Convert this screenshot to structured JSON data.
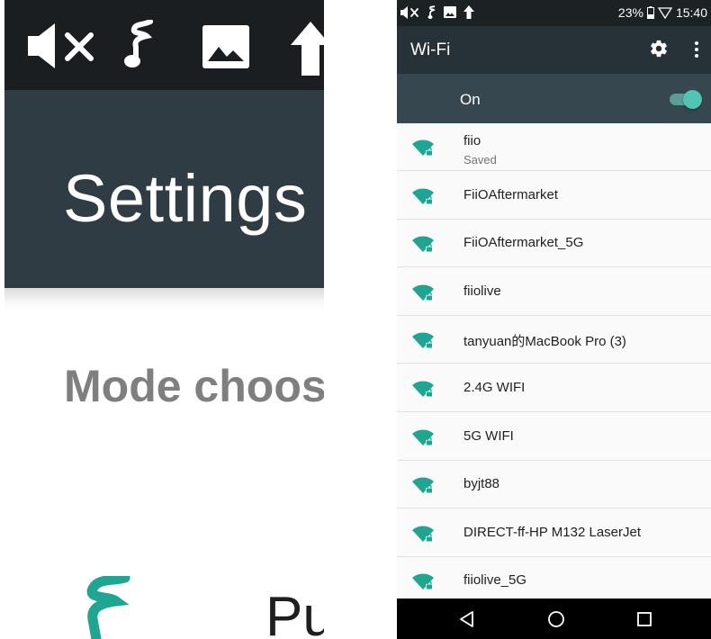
{
  "zoom_panel": {
    "title": "Settings",
    "section_label": "Mode choos",
    "item_label": "Pu",
    "status_icons": [
      "volume-muted-icon",
      "music-note-icon",
      "image-icon",
      "upload-arrow-icon"
    ],
    "logo_icon": "fiio-logo-icon"
  },
  "status_bar": {
    "left_icons": [
      "volume-muted-icon",
      "music-note-icon",
      "image-icon",
      "upload-arrow-icon"
    ],
    "battery": "23%",
    "time": "15:40"
  },
  "app_bar": {
    "title": "Wi-Fi",
    "settings_icon": "gear-icon",
    "overflow_icon": "more-vert-icon"
  },
  "wifi_toggle": {
    "label": "On",
    "state": "on"
  },
  "networks": [
    {
      "ssid": "fiio",
      "status": "Saved"
    },
    {
      "ssid": "FiiOAftermarket",
      "status": ""
    },
    {
      "ssid": "FiiOAftermarket_5G",
      "status": ""
    },
    {
      "ssid": "fiiolive",
      "status": ""
    },
    {
      "ssid": "tanyuan的MacBook Pro (3)",
      "status": ""
    },
    {
      "ssid": "2.4G WIFI",
      "status": ""
    },
    {
      "ssid": "5G WIFI",
      "status": ""
    },
    {
      "ssid": "byjt88",
      "status": ""
    },
    {
      "ssid": "DIRECT-ff-HP M132 LaserJet",
      "status": ""
    },
    {
      "ssid": "fiiolive_5G",
      "status": ""
    }
  ],
  "nav_bar": {
    "buttons": [
      "back-icon",
      "home-icon",
      "recents-icon"
    ]
  },
  "colors": {
    "status_bar": "#1c2124",
    "app_bar": "#263238",
    "toggle_row": "#37474f",
    "accent": "#1fa591",
    "list_bg": "#fafafa"
  }
}
